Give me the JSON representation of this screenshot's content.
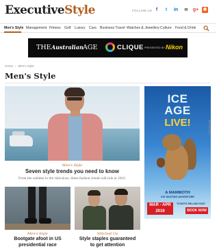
{
  "header": {
    "logo_main": "Executive",
    "logo_accent": "Style",
    "follow_label": "FOLLOW US",
    "social_icons": [
      "facebook-icon",
      "twitter-icon",
      "linkedin-icon",
      "email-icon",
      "google-plus-icon",
      "rss-icon"
    ],
    "social_glyphs": {
      "facebook": "f",
      "twitter": "t",
      "linkedin": "in",
      "email": "✉",
      "google_plus": "g+",
      "rss": "◉"
    }
  },
  "nav": {
    "items": [
      {
        "label": "Men's Style",
        "active": true
      },
      {
        "label": "Management",
        "active": false
      },
      {
        "label": "Fitness",
        "active": false
      },
      {
        "label": "Golf",
        "active": false
      },
      {
        "label": "Luxury",
        "active": false
      },
      {
        "label": "Cars",
        "active": false
      },
      {
        "label": "Business Travel",
        "active": false
      },
      {
        "label": "Watches & Jewellery",
        "active": false
      },
      {
        "label": "Culture",
        "active": false
      },
      {
        "label": "Food & Drink",
        "active": false
      }
    ],
    "search_icon": "search-icon"
  },
  "banner": {
    "the": "THE",
    "brand": "Australian",
    "age": "AGE",
    "clique": "CLIQUE",
    "presented_by": "PRESENTED BY",
    "sponsor": "Nikon"
  },
  "breadcrumb": {
    "home": "Home",
    "separator": "›",
    "current": "Men's Style"
  },
  "page_title": "Men's Style",
  "hero": {
    "category": "Men's Style",
    "headline": "Seven style trends you need to know",
    "summary": "From the sublime to the ridiculous, these fashion trends will rule in 2016."
  },
  "cards": [
    {
      "category": "Men's Style",
      "headline_line1": "Bootgate afoot in US",
      "headline_line2": "presidential race"
    },
    {
      "category": "Stitched Up",
      "headline_line1": "Style staples guaranteed",
      "headline_line2": "to get attention"
    }
  ],
  "ad": {
    "line1": "ICE",
    "line2": "AGE",
    "line3": "LIVE!",
    "mammoth": "A MAMMOTH",
    "mammoth_sub": "ICE SKATING ADVENTURE",
    "dates_line1": "MAR - APR",
    "dates_line2": "2016",
    "tickets": "TICKETS SELLING FAST",
    "book_now": "BOOK NOW",
    "ad_label": "Advertisement"
  },
  "colors": {
    "accent": "#b15d1e",
    "banner_bg": "#0b0b0b",
    "nikon_yellow": "#f4d40b",
    "ad_red": "#d71f26"
  }
}
